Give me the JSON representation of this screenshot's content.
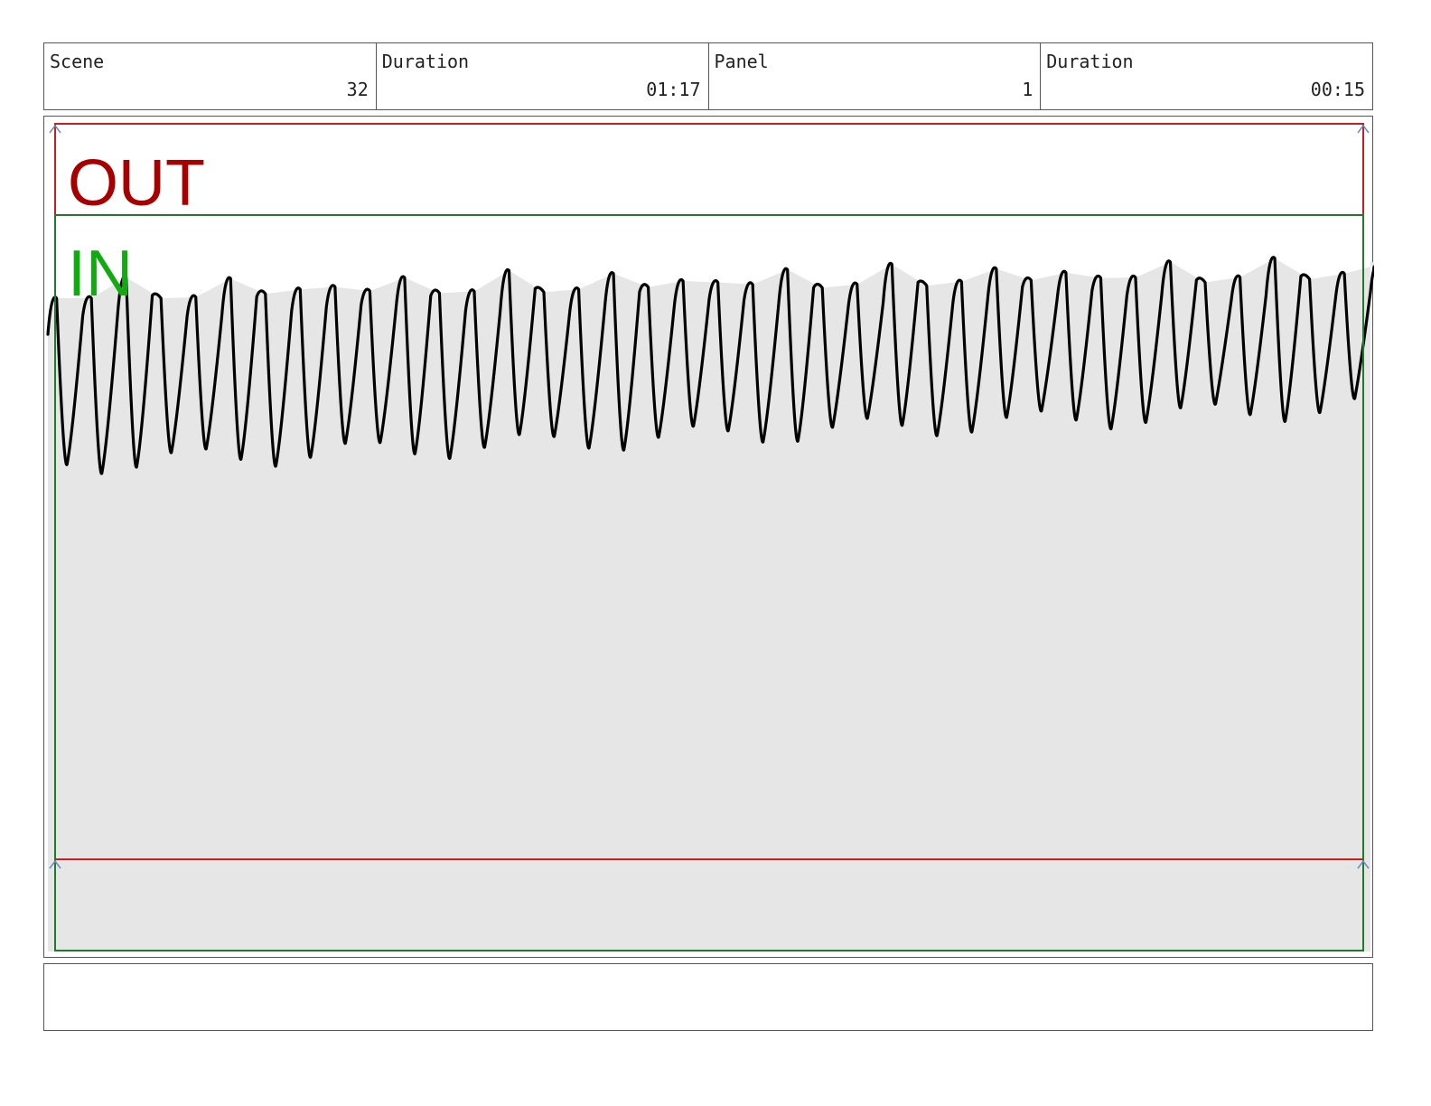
{
  "header": {
    "cells": [
      {
        "label": "Scene",
        "value": "32"
      },
      {
        "label": "Duration",
        "value": "01:17"
      },
      {
        "label": "Panel",
        "value": "1"
      },
      {
        "label": "Duration",
        "value": "00:15"
      }
    ]
  },
  "panel": {
    "out_label": "OUT",
    "in_label": "IN",
    "out_color": "#a80000",
    "in_color": "#11aa11",
    "frame_color": "#c81e1e",
    "safe_color": "#1f7a2a",
    "fill_color": "#e6e6e6"
  },
  "notes": {
    "text": ""
  }
}
